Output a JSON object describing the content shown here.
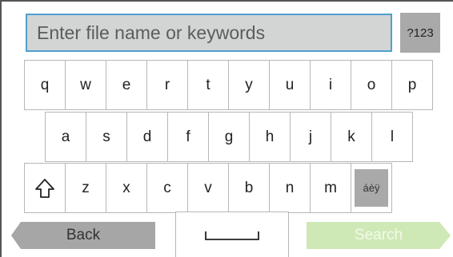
{
  "search": {
    "placeholder": "Enter file name or keywords"
  },
  "mode_key": {
    "label": "?123"
  },
  "keyboard": {
    "row1": [
      "q",
      "w",
      "e",
      "r",
      "t",
      "y",
      "u",
      "i",
      "o",
      "p"
    ],
    "row2": [
      "a",
      "s",
      "d",
      "f",
      "g",
      "h",
      "j",
      "k",
      "l"
    ],
    "row3": [
      "z",
      "x",
      "c",
      "v",
      "b",
      "n",
      "m"
    ],
    "shift_icon": "shift-arrow-up-icon",
    "accent_key_label": "áèÿ",
    "space_icon": "space-bar-icon"
  },
  "actions": {
    "back_label": "Back",
    "search_label": "Search"
  },
  "colors": {
    "field_background": "#d3d5d4",
    "field_border": "#4f9fcf",
    "special_key": "#a9a9a9",
    "back_button": "#a6a6a6",
    "search_button": "#cfe9b6"
  }
}
